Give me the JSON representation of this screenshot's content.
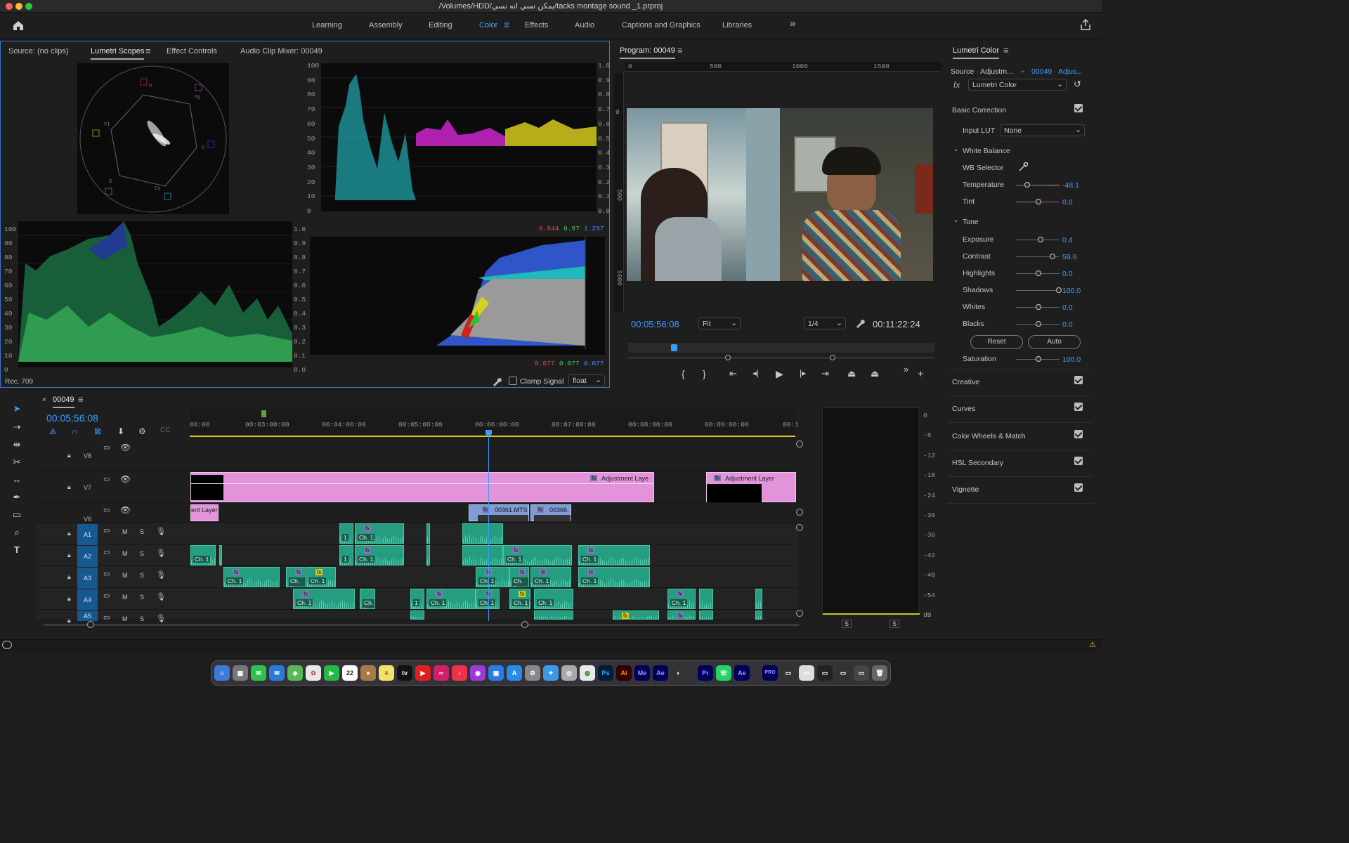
{
  "window": {
    "title": "/Volumes/HDD/يمكن نسي  انه نسي/tacks montage sound _1.prproj"
  },
  "workspaces": {
    "tabs": [
      "Learning",
      "Assembly",
      "Editing",
      "Color",
      "Effects",
      "Audio",
      "Captions and Graphics",
      "Libraries"
    ],
    "active": "Color",
    "more": "»"
  },
  "source_panel": {
    "tabs": [
      "Source: (no clips)",
      "Lumetri Scopes",
      "Effect Controls",
      "Audio Clip Mixer: 00049"
    ],
    "active": "Lumetri Scopes",
    "colorspace": "Rec. 709",
    "clamp_signal_label": "Clamp Signal",
    "bit_depth": "float",
    "waveform_left_axis": [
      "100",
      "90",
      "80",
      "70",
      "60",
      "50",
      "40",
      "30",
      "20",
      "10",
      "0"
    ],
    "waveform_right_axis": [
      "1.0",
      "0.9",
      "0.8",
      "0.7",
      "0.6",
      "0.5",
      "0.4",
      "0.3",
      "0.2",
      "0.1",
      "0.0"
    ],
    "histogram_top": {
      "r": "0.844",
      "g": "0.97",
      "b": "1.297"
    },
    "histogram_bottom": {
      "r": "0.077",
      "g": "0.077",
      "b": "0.077"
    },
    "vectorscope_labels": [
      "R",
      "Mg",
      "B",
      "Cy",
      "G",
      "Yl"
    ]
  },
  "program": {
    "tab": "Program: 00049",
    "ruler": [
      "0",
      "500",
      "1000",
      "1500"
    ],
    "left_ruler": [
      "0",
      "500",
      "1000"
    ],
    "timecode": "00:05:56:08",
    "fit": "Fit",
    "resolution": "1/4",
    "duration": "00:11:22:24",
    "playhead_fraction": 0.14
  },
  "lumetri": {
    "title": "Lumetri Color",
    "source": "Source · Adjustm...",
    "target": "00049 · Adjus...",
    "effect": "Lumetri Color",
    "basic_correction": "Basic Correction",
    "input_lut_label": "Input LUT",
    "input_lut": "None",
    "white_balance": "White Balance",
    "wb_selector": "WB Selector",
    "tone": "Tone",
    "params": [
      {
        "label": "Temperature",
        "value": "-48.1"
      },
      {
        "label": "Tint",
        "value": "0.0"
      },
      {
        "label": "Exposure",
        "value": "0.4"
      },
      {
        "label": "Contrast",
        "value": "59.6"
      },
      {
        "label": "Highlights",
        "value": "0.0"
      },
      {
        "label": "Shadows",
        "value": "100.0"
      },
      {
        "label": "Whites",
        "value": "0.0"
      },
      {
        "label": "Blacks",
        "value": "0.0"
      }
    ],
    "reset": "Reset",
    "auto": "Auto",
    "saturation_label": "Saturation",
    "saturation": "100.0",
    "sections": [
      "Creative",
      "Curves",
      "Color Wheels & Match",
      "HSL Secondary",
      "Vignette"
    ]
  },
  "timeline": {
    "tab": "00049",
    "timecode": "00:05:56:08",
    "ruler": [
      "00:00",
      "00:03:00:00",
      "00:04:00:00",
      "00:05:00:00",
      "00:06:00:00",
      "00:07:00:00",
      "00:08:00:00",
      "00:09:00:00",
      "00:1"
    ],
    "video_tracks": [
      "V8",
      "V7",
      "V6"
    ],
    "audio_tracks": [
      "A1",
      "A2",
      "A3",
      "A4",
      "A5"
    ],
    "mute": "M",
    "solo": "S",
    "adjustment_layer": "Adjustment Laye",
    "adjustment_layer2": "Adjustment Layer",
    "adjustment_layer_short": "ent Layer",
    "clip1": "00361.MTS",
    "clip2": "00366.",
    "ch": "Ch. 1",
    "one": "1"
  },
  "audio_meter": {
    "scale": [
      "0",
      "-6",
      "-12",
      "-18",
      "-24",
      "-30",
      "-36",
      "-42",
      "-48",
      "-54",
      "dB"
    ],
    "solo": [
      "S",
      "S"
    ]
  },
  "dock": {
    "date": "22",
    "apps": [
      "Ps",
      "Ai",
      "Me",
      "Ae",
      "Pr",
      "Ae"
    ]
  }
}
